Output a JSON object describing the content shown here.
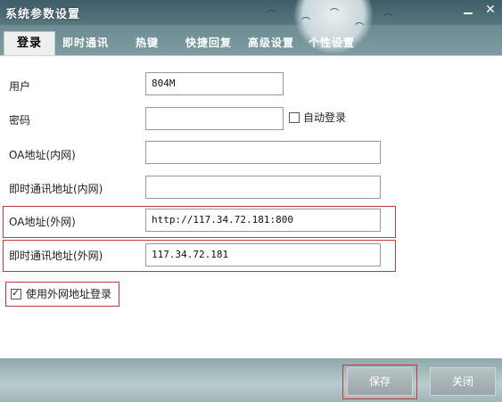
{
  "window": {
    "title": "系统参数设置"
  },
  "tabs": [
    {
      "label": "登录",
      "active": true
    },
    {
      "label": "即时通讯"
    },
    {
      "label": "热键"
    },
    {
      "label": "快捷回复"
    },
    {
      "label": "高级设置"
    },
    {
      "label": "个性设置"
    }
  ],
  "form": {
    "user_label": "用户",
    "user_value": "804M",
    "password_label": "密码",
    "password_value": "",
    "auto_login_label": "自动登录",
    "auto_login_checked": false,
    "oa_internal_label": "OA地址(内网)",
    "oa_internal_value": "",
    "im_internal_label": "即时通讯地址(内网)",
    "im_internal_value": "",
    "oa_external_label": "OA地址(外网)",
    "oa_external_value": "http://117.34.72.181:800",
    "im_external_label": "即时通讯地址(外网)",
    "im_external_value": "117.34.72.181",
    "use_external_label": "使用外网地址登录",
    "use_external_checked": true
  },
  "buttons": {
    "save": "保存",
    "close": "关闭"
  },
  "colors": {
    "highlight": "#c0393b"
  }
}
